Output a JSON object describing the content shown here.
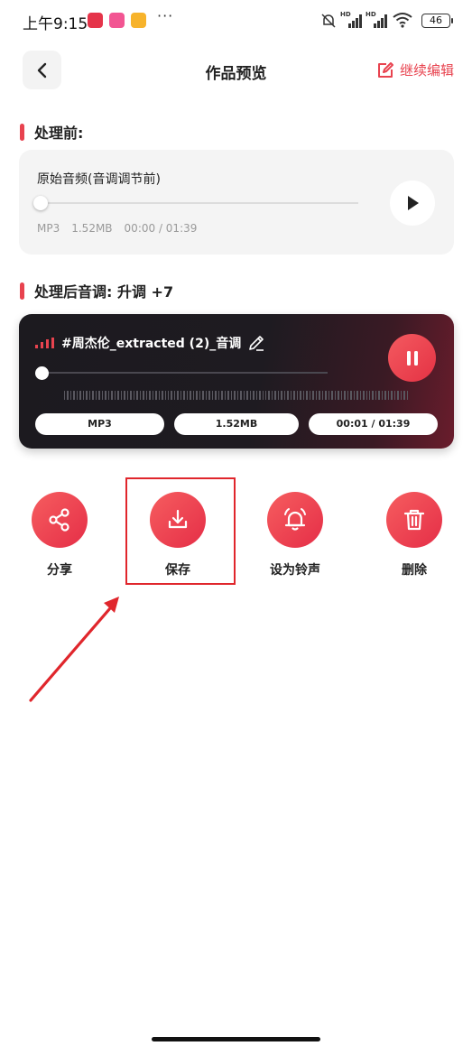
{
  "status_bar": {
    "time": "上午9:15",
    "dots": "···",
    "battery": "46",
    "signal1": "HD",
    "signal2": "HD"
  },
  "header": {
    "title": "作品预览",
    "continue_edit": "继续编辑"
  },
  "before": {
    "heading": "处理前:",
    "card_title": "原始音频(音调调节前)",
    "format": "MP3",
    "size": "1.52MB",
    "time": "00:00 / 01:39",
    "progress": 0
  },
  "after": {
    "heading": "处理后音调: 升调 +7",
    "file_name": "#周杰伦_extracted (2)_音调",
    "format": "MP3",
    "size": "1.52MB",
    "time": "00:01 / 01:39",
    "progress": 0.01
  },
  "actions": [
    {
      "label": "分享",
      "icon": "share-icon"
    },
    {
      "label": "保存",
      "icon": "download-icon"
    },
    {
      "label": "设为铃声",
      "icon": "bell-icon"
    },
    {
      "label": "删除",
      "icon": "trash-icon"
    }
  ],
  "colors": {
    "accent": "#e8434f",
    "annotation": "#e0262c"
  }
}
